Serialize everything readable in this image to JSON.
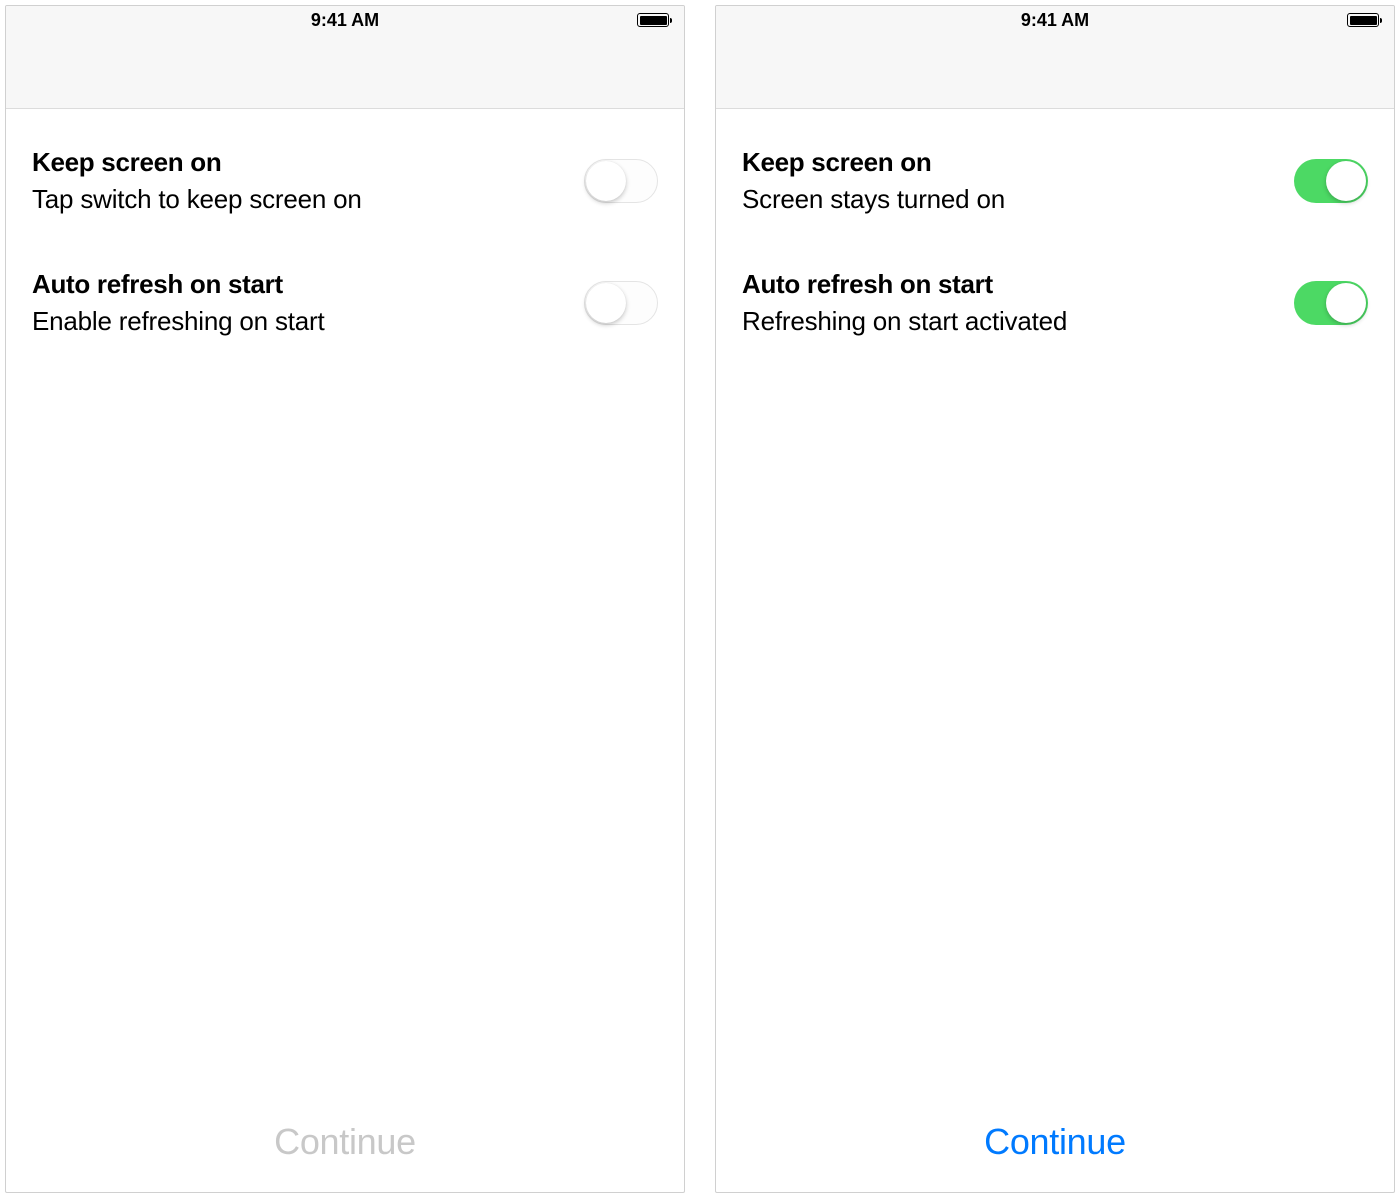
{
  "status": {
    "time": "9:41 AM"
  },
  "screens": [
    {
      "settings": [
        {
          "title": "Keep screen on",
          "subtitle": "Tap switch to keep screen on",
          "toggle": "off"
        },
        {
          "title": "Auto refresh on start",
          "subtitle": "Enable refreshing on start",
          "toggle": "off"
        }
      ],
      "continue": {
        "label": "Continue",
        "state": "disabled"
      }
    },
    {
      "settings": [
        {
          "title": "Keep screen on",
          "subtitle": "Screen stays turned on",
          "toggle": "on"
        },
        {
          "title": "Auto refresh on start",
          "subtitle": "Refreshing on start activated",
          "toggle": "on"
        }
      ],
      "continue": {
        "label": "Continue",
        "state": "enabled"
      }
    }
  ]
}
